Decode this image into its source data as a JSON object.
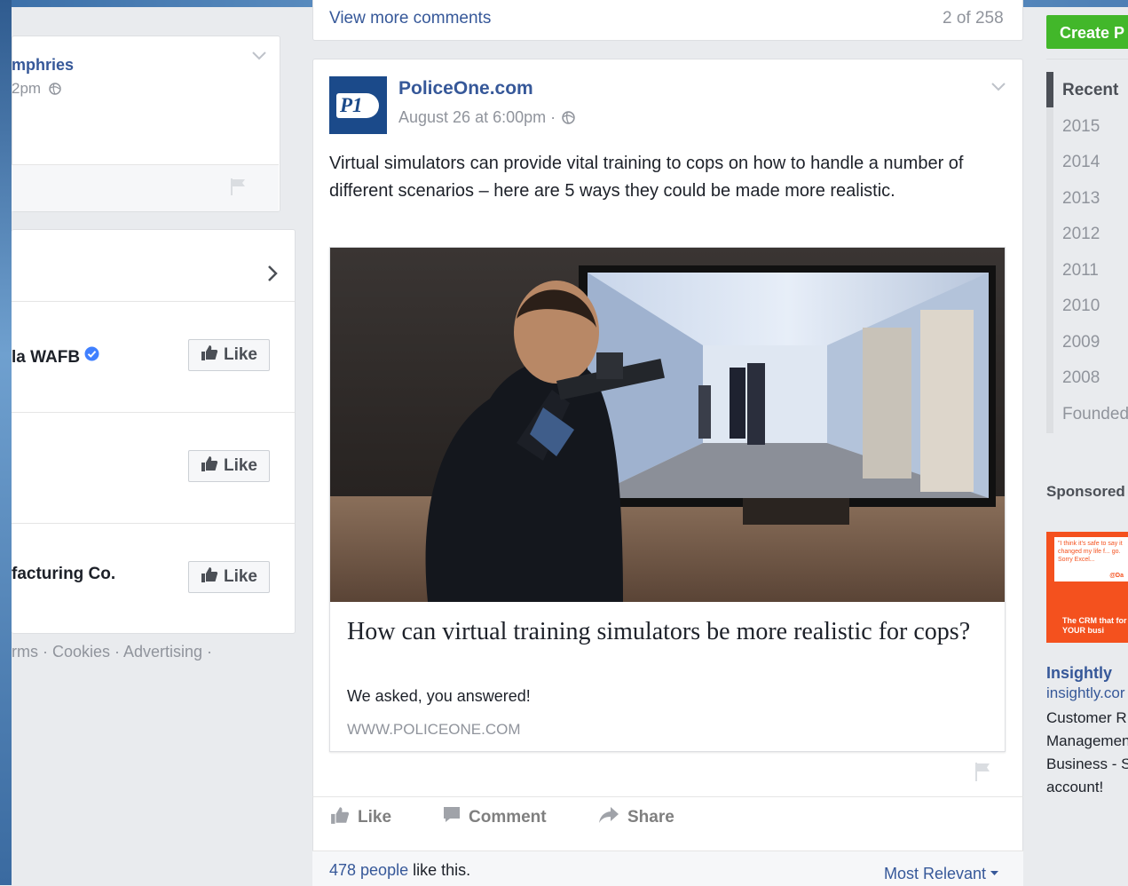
{
  "left": {
    "post": {
      "author": "mphries",
      "time": "2pm"
    },
    "pages": [
      {
        "name": "la WAFB",
        "verified": true,
        "like_label": "Like"
      },
      {
        "name": "",
        "verified": false,
        "like_label": "Like"
      },
      {
        "name": "facturing Co.",
        "verified": false,
        "like_label": "Like"
      }
    ],
    "footer": "rms · Cookies · Advertising ·"
  },
  "main": {
    "view_more": "View more comments",
    "comment_count": "2 of 258",
    "post": {
      "author": "PoliceOne.com",
      "avatar_text": "P1",
      "date": "August 26 at 6:00pm ·",
      "text": "Virtual simulators can provide vital training to cops on how to handle a number of different scenarios – here are 5 ways they could be made more realistic.",
      "link": {
        "title": "How can virtual training simulators be more realistic for cops?",
        "description": "We asked, you answered!",
        "domain": "WWW.POLICEONE.COM"
      },
      "actions": {
        "like": "Like",
        "comment": "Comment",
        "share": "Share"
      },
      "likes_count": "478 people",
      "likes_suffix": " like this.",
      "sort": "Most Relevant"
    }
  },
  "right": {
    "create_button": "Create P",
    "timeline": [
      "Recent",
      "2015",
      "2014",
      "2013",
      "2012",
      "2011",
      "2010",
      "2009",
      "2008",
      "Founded"
    ],
    "sponsored_title": "Sponsored",
    "ad": {
      "image_quote": "\"I think it's safe to say it changed my life f... go. Sorry Excel...",
      "image_handle": "@Da",
      "image_tagline": "The CRM that for YOUR busi",
      "name": "Insightly",
      "url": "insightly.cor",
      "description": "Customer R\nManagemen\nBusiness - S\naccount!"
    }
  },
  "colors": {
    "link": "#365899",
    "green": "#42b72a",
    "meta": "#90949c",
    "ad_orange": "#f4511e"
  }
}
